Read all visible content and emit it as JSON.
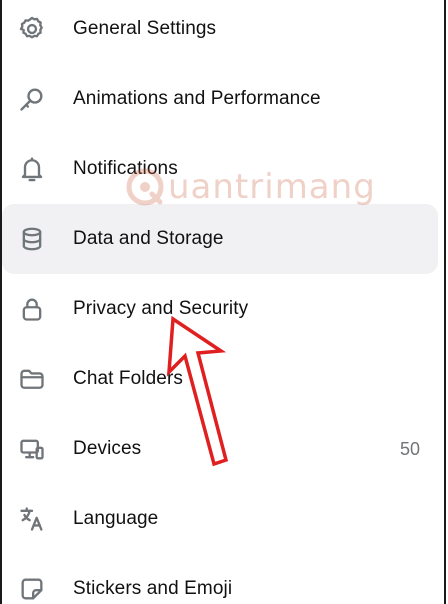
{
  "menu": {
    "items": [
      {
        "label": "General Settings",
        "icon": "gear-icon"
      },
      {
        "label": "Animations and Performance",
        "icon": "magic-wand-icon"
      },
      {
        "label": "Notifications",
        "icon": "bell-icon"
      },
      {
        "label": "Data and Storage",
        "icon": "database-icon"
      },
      {
        "label": "Privacy and Security",
        "icon": "lock-icon"
      },
      {
        "label": "Chat Folders",
        "icon": "folder-icon"
      },
      {
        "label": "Devices",
        "icon": "devices-icon",
        "count": "50"
      },
      {
        "label": "Language",
        "icon": "translate-icon"
      },
      {
        "label": "Stickers and Emoji",
        "icon": "sticker-icon"
      }
    ]
  },
  "annotation": {
    "arrow_color": "#e02020",
    "arrow_icon": "arrow-annotation-icon"
  },
  "watermark": {
    "text": "uantrimang",
    "logo": "quantrimang-logo",
    "color": "#c85c3c"
  },
  "colors": {
    "icon": "#707579",
    "text": "#111111",
    "hover_background": "#f1f1f3"
  }
}
